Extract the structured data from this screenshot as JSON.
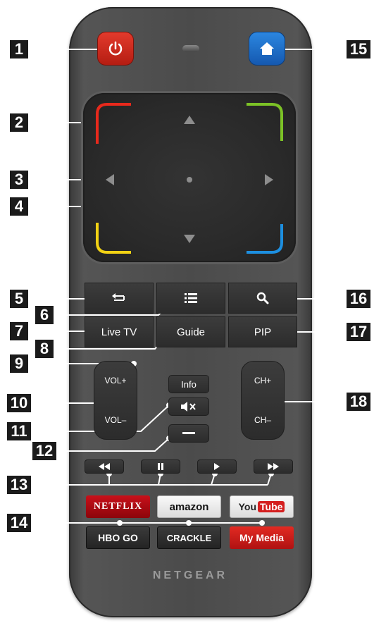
{
  "callouts": [
    "1",
    "2",
    "3",
    "4",
    "5",
    "6",
    "7",
    "8",
    "9",
    "10",
    "11",
    "12",
    "13",
    "14",
    "15",
    "16",
    "17",
    "18"
  ],
  "buttons": {
    "live_tv": "Live TV",
    "guide": "Guide",
    "pip": "PIP",
    "info": "Info",
    "vol_up": "VOL+",
    "vol_down": "VOL–",
    "ch_up": "CH+",
    "ch_down": "CH–"
  },
  "streaming": {
    "netflix": "NETFLIX",
    "amazon": "amazon",
    "youtube_you": "You",
    "youtube_tube": "Tube",
    "hbo": "HBO GO",
    "crackle": "CRACKLE",
    "my_media": "My Media"
  },
  "brand": "NETGEAR",
  "colors": {
    "power": "#d62a1d",
    "home": "#1f6fc9",
    "pad_red": "#e8291c",
    "pad_green": "#7cc226",
    "pad_yellow": "#f2d214",
    "pad_blue": "#1d8fe0",
    "netflix": "#b20710",
    "youtube": "#d41f1f",
    "my_media": "#d41f1f"
  },
  "icons": [
    "power-icon",
    "home-icon",
    "back-icon",
    "menu-icon",
    "search-icon",
    "mute-icon",
    "minus-icon",
    "rewind-icon",
    "pause-icon",
    "play-icon",
    "fast-forward-icon"
  ]
}
